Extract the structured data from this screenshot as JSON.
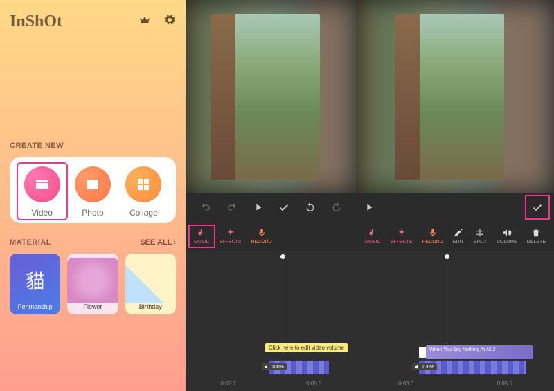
{
  "sidebar": {
    "logo": "InShOt",
    "create_title": "CREATE NEW",
    "create": [
      {
        "label": "Video"
      },
      {
        "label": "Photo"
      },
      {
        "label": "Collage"
      }
    ],
    "material_title": "MATERIAL",
    "see_all": "SEE ALL",
    "materials": [
      {
        "label": "Penmanship",
        "glyph": "貓"
      },
      {
        "label": "Flower"
      },
      {
        "label": "Birthday"
      }
    ]
  },
  "panel_left": {
    "tools": [
      {
        "key": "music",
        "label": "MUSIC"
      },
      {
        "key": "effects",
        "label": "EFFECTS"
      },
      {
        "key": "record",
        "label": "RECORD"
      }
    ],
    "hint": "Click here to edit video volume",
    "volume_badge": "100%",
    "time_a": "0:02.7",
    "time_b": "0:05.5"
  },
  "panel_right": {
    "tools": [
      {
        "key": "music",
        "label": "MUSIC"
      },
      {
        "key": "effects",
        "label": "EFFECTS"
      },
      {
        "key": "record",
        "label": "RECORD"
      },
      {
        "key": "edit",
        "label": "EDIT"
      },
      {
        "key": "split",
        "label": "SPLIT"
      },
      {
        "key": "volume",
        "label": "VOLUME"
      },
      {
        "key": "delete",
        "label": "DELETE"
      }
    ],
    "audio_title": "When You Say Nothing At All 2",
    "volume_badge": "100%",
    "time_a": "0:03.6",
    "time_b": "0:05.5"
  }
}
